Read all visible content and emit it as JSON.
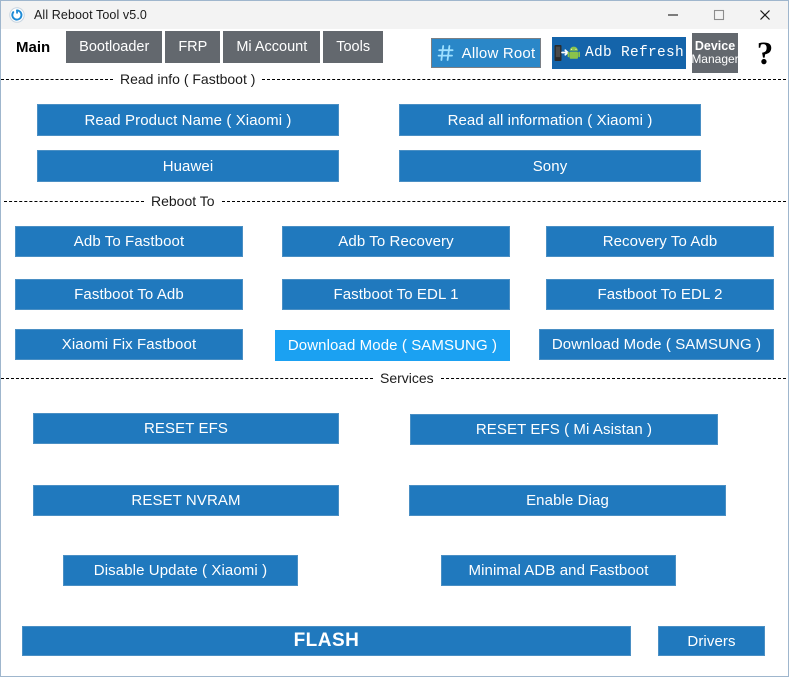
{
  "window": {
    "title": "All Reboot Tool v5.0",
    "app_icon": "power-reboot-icon",
    "controls": {
      "minimize": "minimize-icon",
      "maximize": "maximize-icon",
      "close": "close-icon"
    }
  },
  "tabs": [
    {
      "label": "Main",
      "active": true
    },
    {
      "label": "Bootloader",
      "active": false
    },
    {
      "label": "FRP",
      "active": false
    },
    {
      "label": "Mi Account",
      "active": false
    },
    {
      "label": "Tools",
      "active": false
    }
  ],
  "toolbar": {
    "allow_root": "Allow Root",
    "allow_root_icon": "hash-icon",
    "adb_refresh": "Adb Refresh",
    "adb_refresh_icon": "phone-android-sync-icon",
    "device_manager_line1": "Device",
    "device_manager_line2": "Manager",
    "help": "?"
  },
  "sections": {
    "read_info": "Read info ( Fastboot )",
    "reboot_to": "Reboot To",
    "services": "Services"
  },
  "buttons": {
    "read_product_name": "Read Product Name ( Xiaomi )",
    "read_all_information": "Read all information ( Xiaomi )",
    "huawei": "Huawei",
    "sony": "Sony",
    "adb_to_fastboot": "Adb To Fastboot",
    "adb_to_recovery": "Adb To Recovery",
    "recovery_to_adb": "Recovery To Adb",
    "fastboot_to_adb": "Fastboot To Adb",
    "fastboot_to_edl1": "Fastboot To EDL 1",
    "fastboot_to_edl2": "Fastboot To EDL 2",
    "xiaomi_fix_fastboot": "Xiaomi Fix Fastboot",
    "download_mode_1": "Download Mode ( SAMSUNG )",
    "download_mode_2": "Download Mode ( SAMSUNG )",
    "reset_efs": "RESET EFS",
    "reset_efs_mi_asistan": "RESET EFS ( Mi Asistan )",
    "reset_nvram": "RESET NVRAM",
    "enable_diag": "Enable Diag",
    "disable_update": "Disable Update ( Xiaomi )",
    "minimal_adb_fastboot": "Minimal ADB and Fastboot",
    "flash": "FLASH",
    "drivers": "Drivers"
  },
  "colors": {
    "button_blue": "#2079be",
    "button_blue_hover": "#1ba1f2",
    "tab_inactive": "#63686e",
    "adb_button_blue": "#1464aa",
    "allow_root_blue": "#2a87c8",
    "titlebar": "#f3f3f3",
    "window_border": "#9fb6cd"
  }
}
